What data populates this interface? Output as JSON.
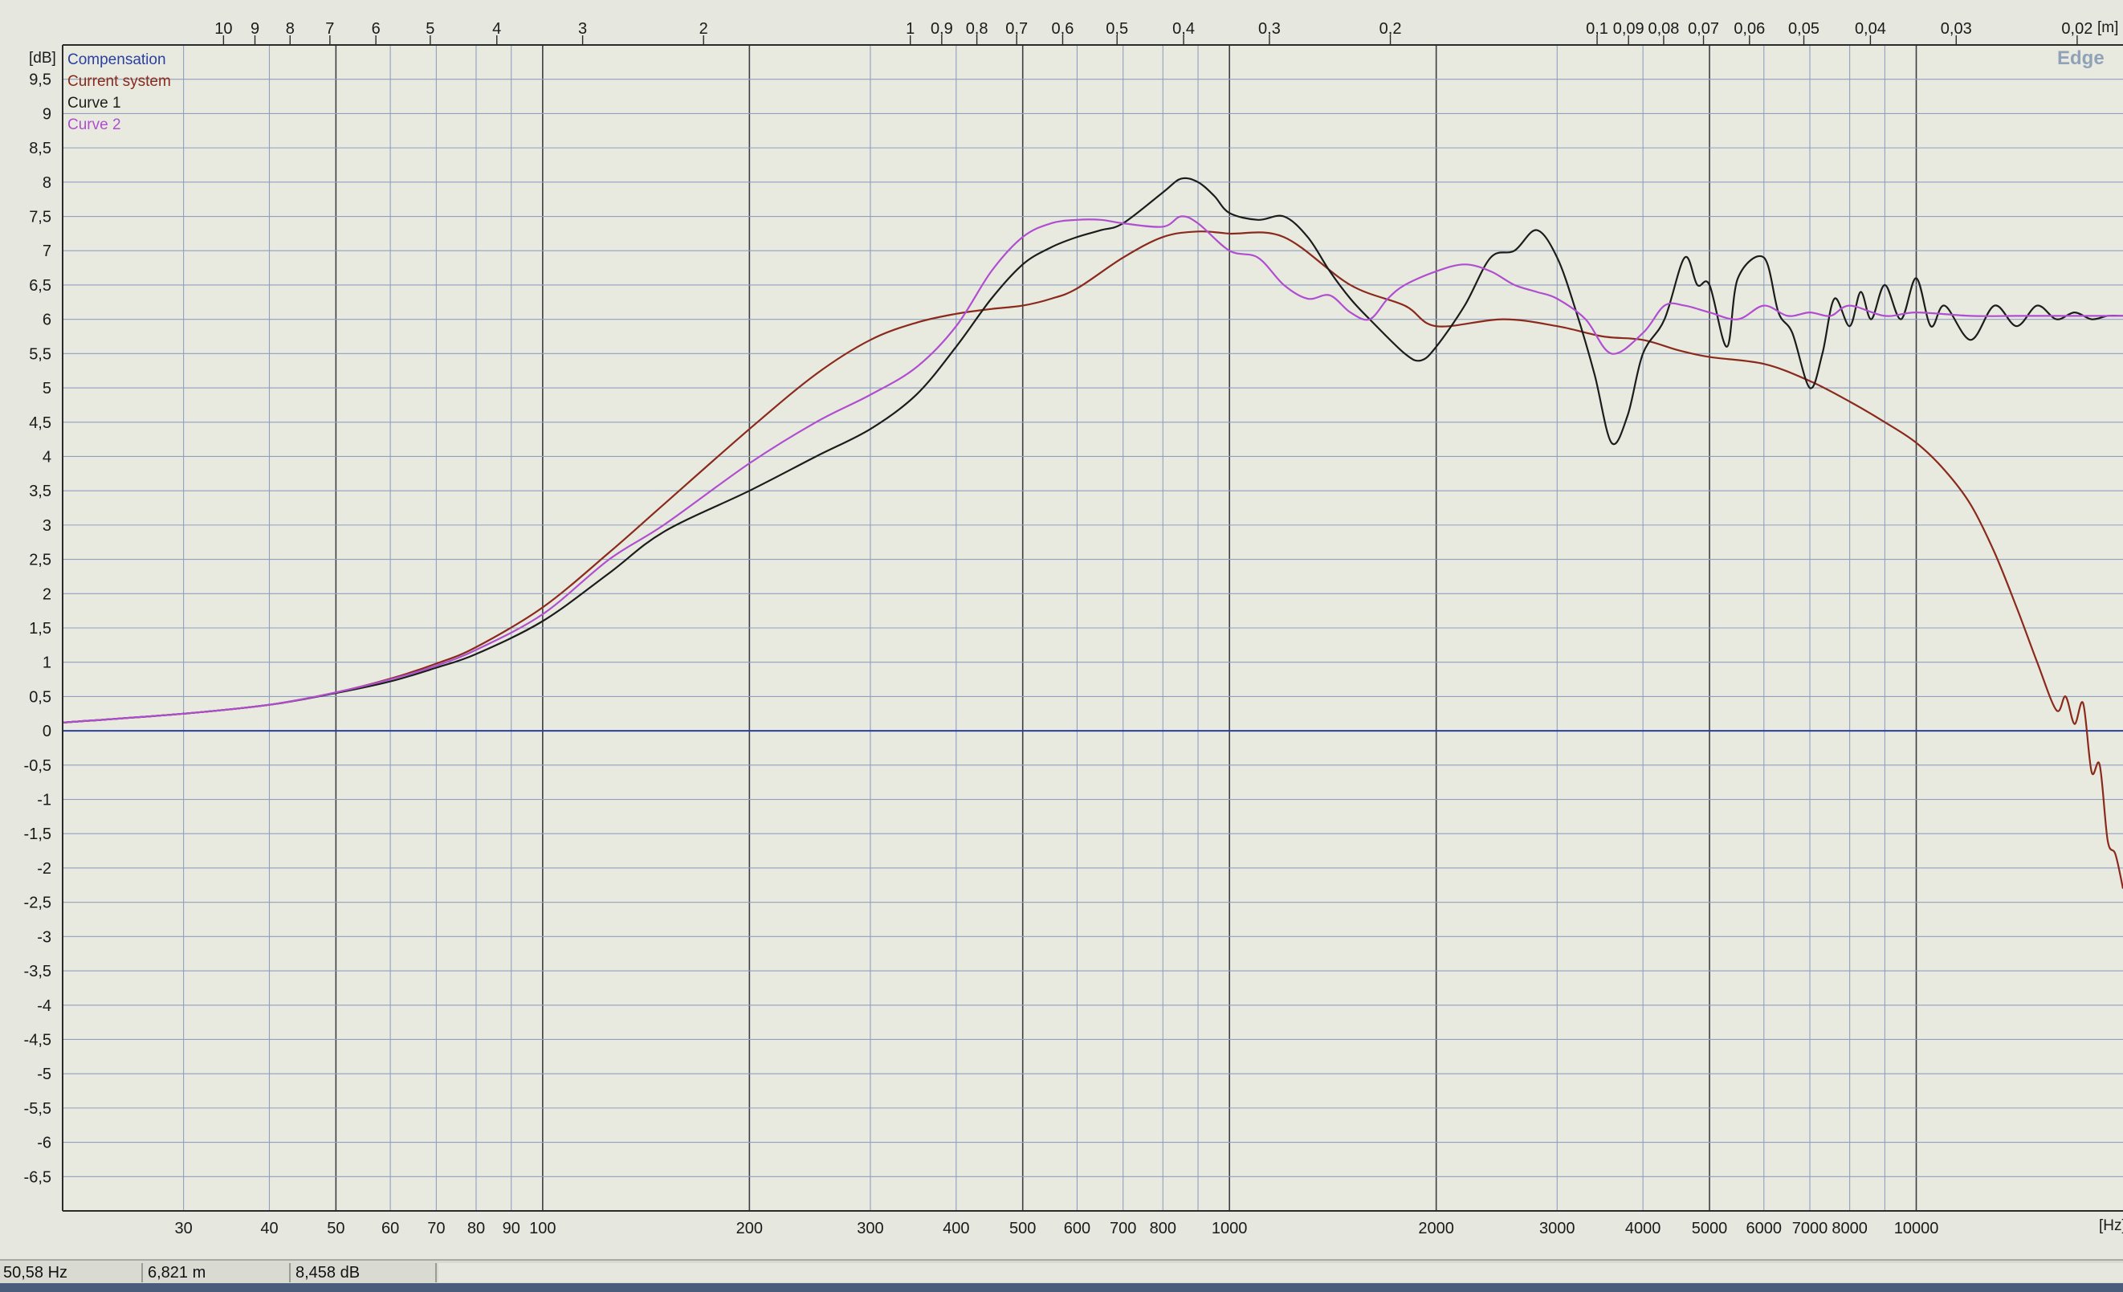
{
  "chart_data": {
    "type": "line",
    "x_scale": "log",
    "x_unit": "[Hz]",
    "y_unit": "[dB]",
    "top_axis_unit": "[m]",
    "xlim": [
      20,
      20000
    ],
    "ylim": [
      -7,
      10
    ],
    "grid": true,
    "legend_position": "top-left",
    "zero_line_color": "#2a3fa0",
    "brand_label": "Edge",
    "x_ticks": [
      {
        "v": 30,
        "label": "30"
      },
      {
        "v": 40,
        "label": "40"
      },
      {
        "v": 50,
        "label": "50"
      },
      {
        "v": 60,
        "label": "60"
      },
      {
        "v": 70,
        "label": "70"
      },
      {
        "v": 80,
        "label": "80"
      },
      {
        "v": 90,
        "label": "90"
      },
      {
        "v": 100,
        "label": "100"
      },
      {
        "v": 200,
        "label": "200"
      },
      {
        "v": 300,
        "label": "300"
      },
      {
        "v": 400,
        "label": "400"
      },
      {
        "v": 500,
        "label": "500"
      },
      {
        "v": 600,
        "label": "600"
      },
      {
        "v": 700,
        "label": "700"
      },
      {
        "v": 800,
        "label": "800"
      },
      {
        "v": 1000,
        "label": "1000"
      },
      {
        "v": 2000,
        "label": "2000"
      },
      {
        "v": 3000,
        "label": "3000"
      },
      {
        "v": 4000,
        "label": "4000"
      },
      {
        "v": 5000,
        "label": "5000"
      },
      {
        "v": 6000,
        "label": "6000"
      },
      {
        "v": 7000,
        "label": "7000"
      },
      {
        "v": 8000,
        "label": "8000"
      },
      {
        "v": 10000,
        "label": "10000"
      }
    ],
    "top_ticks": [
      {
        "m": 10,
        "label": "10"
      },
      {
        "m": 9,
        "label": "9"
      },
      {
        "m": 8,
        "label": "8"
      },
      {
        "m": 7,
        "label": "7"
      },
      {
        "m": 6,
        "label": "6"
      },
      {
        "m": 5,
        "label": "5"
      },
      {
        "m": 4,
        "label": "4"
      },
      {
        "m": 3,
        "label": "3"
      },
      {
        "m": 2,
        "label": "2"
      },
      {
        "m": 1,
        "label": "1"
      },
      {
        "m": 0.9,
        "label": "0,9"
      },
      {
        "m": 0.8,
        "label": "0,8"
      },
      {
        "m": 0.7,
        "label": "0,7"
      },
      {
        "m": 0.6,
        "label": "0,6"
      },
      {
        "m": 0.5,
        "label": "0,5"
      },
      {
        "m": 0.4,
        "label": "0,4"
      },
      {
        "m": 0.3,
        "label": "0,3"
      },
      {
        "m": 0.2,
        "label": "0,2"
      },
      {
        "m": 0.1,
        "label": "0,1"
      },
      {
        "m": 0.09,
        "label": "0,09"
      },
      {
        "m": 0.08,
        "label": "0,08"
      },
      {
        "m": 0.07,
        "label": "0,07"
      },
      {
        "m": 0.06,
        "label": "0,06"
      },
      {
        "m": 0.05,
        "label": "0,05"
      },
      {
        "m": 0.04,
        "label": "0,04"
      },
      {
        "m": 0.03,
        "label": "0,03"
      },
      {
        "m": 0.02,
        "label": "0,02"
      }
    ],
    "y_ticks": [
      {
        "v": 9.5,
        "label": "9,5"
      },
      {
        "v": 9,
        "label": "9"
      },
      {
        "v": 8.5,
        "label": "8,5"
      },
      {
        "v": 8,
        "label": "8"
      },
      {
        "v": 7.5,
        "label": "7,5"
      },
      {
        "v": 7,
        "label": "7"
      },
      {
        "v": 6.5,
        "label": "6,5"
      },
      {
        "v": 6,
        "label": "6"
      },
      {
        "v": 5.5,
        "label": "5,5"
      },
      {
        "v": 5,
        "label": "5"
      },
      {
        "v": 4.5,
        "label": "4,5"
      },
      {
        "v": 4,
        "label": "4"
      },
      {
        "v": 3.5,
        "label": "3,5"
      },
      {
        "v": 3,
        "label": "3"
      },
      {
        "v": 2.5,
        "label": "2,5"
      },
      {
        "v": 2,
        "label": "2"
      },
      {
        "v": 1.5,
        "label": "1,5"
      },
      {
        "v": 1,
        "label": "1"
      },
      {
        "v": 0.5,
        "label": "0,5"
      },
      {
        "v": 0,
        "label": "0"
      },
      {
        "v": -0.5,
        "label": "-0,5"
      },
      {
        "v": -1,
        "label": "-1"
      },
      {
        "v": -1.5,
        "label": "-1,5"
      },
      {
        "v": -2,
        "label": "-2"
      },
      {
        "v": -2.5,
        "label": "-2,5"
      },
      {
        "v": -3,
        "label": "-3"
      },
      {
        "v": -3.5,
        "label": "-3,5"
      },
      {
        "v": -4,
        "label": "-4"
      },
      {
        "v": -4.5,
        "label": "-4,5"
      },
      {
        "v": -5,
        "label": "-5"
      },
      {
        "v": -5.5,
        "label": "-5,5"
      },
      {
        "v": -6,
        "label": "-6"
      },
      {
        "v": -6.5,
        "label": "-6,5"
      }
    ],
    "series": [
      {
        "name": "Compensation",
        "color": "#2a3fa0",
        "x": [
          20,
          20000
        ],
        "y": [
          0,
          0
        ]
      },
      {
        "name": "Current system",
        "color": "#8a2a1c",
        "x": [
          20,
          30,
          40,
          50,
          60,
          70,
          80,
          100,
          125,
          150,
          200,
          250,
          300,
          350,
          400,
          450,
          500,
          550,
          600,
          700,
          800,
          900,
          1000,
          1200,
          1500,
          1800,
          2000,
          2500,
          3000,
          3500,
          4000,
          4500,
          5000,
          6000,
          7000,
          8000,
          9000,
          10000,
          11000,
          12000,
          13000,
          14000,
          15000,
          16000,
          16500,
          17000,
          17500,
          18000,
          18500,
          19000,
          19500,
          20000
        ],
        "y": [
          0.12,
          0.25,
          0.38,
          0.56,
          0.76,
          0.98,
          1.22,
          1.8,
          2.6,
          3.3,
          4.4,
          5.2,
          5.7,
          5.95,
          6.08,
          6.15,
          6.2,
          6.3,
          6.45,
          6.9,
          7.2,
          7.28,
          7.25,
          7.2,
          6.5,
          6.2,
          5.9,
          6.0,
          5.9,
          5.75,
          5.7,
          5.55,
          5.45,
          5.35,
          5.1,
          4.8,
          4.5,
          4.2,
          3.8,
          3.3,
          2.6,
          1.8,
          1.0,
          0.3,
          0.5,
          0.1,
          0.4,
          -0.6,
          -0.5,
          -1.6,
          -1.8,
          -2.3
        ]
      },
      {
        "name": "Curve 1",
        "color": "#1c1c1c",
        "x": [
          20,
          30,
          40,
          50,
          60,
          70,
          80,
          100,
          125,
          150,
          200,
          250,
          300,
          350,
          400,
          450,
          500,
          550,
          600,
          650,
          700,
          800,
          850,
          900,
          950,
          1000,
          1100,
          1200,
          1300,
          1400,
          1500,
          1600,
          1800,
          1900,
          2000,
          2200,
          2400,
          2600,
          2800,
          3000,
          3200,
          3400,
          3600,
          3800,
          4000,
          4300,
          4600,
          4800,
          5000,
          5300,
          5500,
          6000,
          6300,
          6600,
          7000,
          7300,
          7600,
          8000,
          8300,
          8600,
          9000,
          9500,
          10000,
          10500,
          11000,
          12000,
          13000,
          14000,
          15000,
          16000,
          17000,
          18000,
          19000,
          20000
        ],
        "y": [
          0.12,
          0.25,
          0.38,
          0.55,
          0.72,
          0.92,
          1.12,
          1.6,
          2.3,
          2.9,
          3.5,
          4.0,
          4.4,
          4.9,
          5.6,
          6.3,
          6.8,
          7.05,
          7.2,
          7.3,
          7.4,
          7.85,
          8.05,
          8.0,
          7.8,
          7.55,
          7.45,
          7.5,
          7.2,
          6.7,
          6.3,
          6.0,
          5.5,
          5.4,
          5.6,
          6.2,
          6.9,
          7.0,
          7.3,
          6.9,
          6.1,
          5.2,
          4.2,
          4.6,
          5.5,
          6.0,
          6.9,
          6.5,
          6.5,
          5.6,
          6.6,
          6.9,
          6.1,
          5.8,
          5.0,
          5.5,
          6.3,
          5.9,
          6.4,
          6.0,
          6.5,
          6.0,
          6.6,
          5.9,
          6.2,
          5.7,
          6.2,
          5.9,
          6.2,
          6.0,
          6.1,
          6.0,
          6.05,
          6.05
        ]
      },
      {
        "name": "Curve 2",
        "color": "#b04ed0",
        "x": [
          20,
          30,
          40,
          50,
          60,
          70,
          80,
          100,
          125,
          150,
          200,
          250,
          300,
          350,
          400,
          450,
          500,
          550,
          600,
          650,
          700,
          800,
          850,
          900,
          1000,
          1100,
          1200,
          1300,
          1400,
          1500,
          1600,
          1700,
          1800,
          2000,
          2200,
          2400,
          2600,
          2800,
          3000,
          3300,
          3600,
          4000,
          4300,
          4600,
          5000,
          5500,
          6000,
          6500,
          7000,
          7500,
          8000,
          9000,
          10000,
          12000,
          14000,
          16000,
          18000,
          20000
        ],
        "y": [
          0.12,
          0.25,
          0.38,
          0.56,
          0.75,
          0.95,
          1.18,
          1.7,
          2.5,
          3.0,
          3.9,
          4.5,
          4.9,
          5.3,
          5.9,
          6.7,
          7.2,
          7.4,
          7.45,
          7.45,
          7.4,
          7.35,
          7.5,
          7.4,
          7.0,
          6.9,
          6.5,
          6.3,
          6.35,
          6.1,
          6.0,
          6.3,
          6.5,
          6.7,
          6.8,
          6.7,
          6.5,
          6.4,
          6.3,
          6.0,
          5.5,
          5.8,
          6.2,
          6.2,
          6.1,
          6.0,
          6.2,
          6.05,
          6.1,
          6.05,
          6.2,
          6.05,
          6.1,
          6.05,
          6.05,
          6.05,
          6.05,
          6.05
        ]
      }
    ]
  },
  "status": {
    "frequency": "50,58 Hz",
    "distance": "6,821 m",
    "level": "8,458 dB"
  }
}
